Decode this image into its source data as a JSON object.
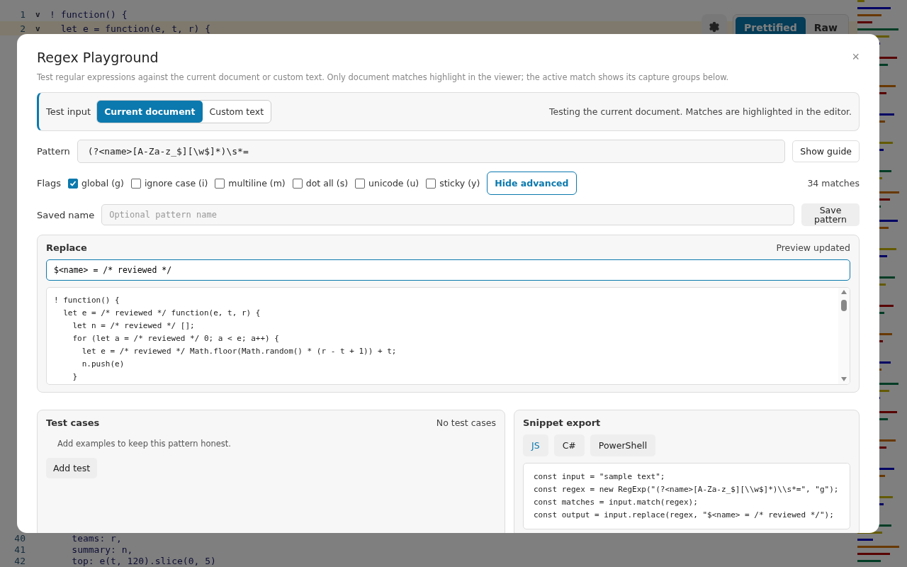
{
  "editor": {
    "lines_top": [
      {
        "number": "1",
        "fold": "v",
        "code": "! function() {",
        "current": false
      },
      {
        "number": "2",
        "fold": "v",
        "code": "  let e = function(e, t, r) {",
        "current": true
      }
    ],
    "lines_bottom": [
      {
        "number": "40",
        "code": "    teams: r,",
        "current": false
      },
      {
        "number": "41",
        "code": "    summary: n,",
        "current": false
      },
      {
        "number": "42",
        "code": "    top: e(t, 120).slice(0, 5)",
        "current": false
      }
    ]
  },
  "view_toggle": [
    {
      "label": "Prettified",
      "selected": true
    },
    {
      "label": "Raw",
      "selected": false
    }
  ],
  "modal": {
    "title": "Regex Playground",
    "close": "×",
    "description": "Test regular expressions against the current document or custom text. Only document matches highlight in the viewer; the active match shows its capture groups below.",
    "test_input": {
      "label": "Test input",
      "options": [
        {
          "label": "Current document",
          "selected": true
        },
        {
          "label": "Custom text",
          "selected": false
        }
      ],
      "status": "Testing the current document. Matches are highlighted in the editor."
    },
    "pattern": {
      "label": "Pattern",
      "value": "(?<name>[A-Za-z_$][\\w$]*)\\s*=",
      "button": "Show guide"
    },
    "flags": {
      "label": "Flags",
      "items": [
        {
          "label": "global (g)",
          "checked": true
        },
        {
          "label": "ignore case (i)",
          "checked": false
        },
        {
          "label": "multiline (m)",
          "checked": false
        },
        {
          "label": "dot all (s)",
          "checked": false
        },
        {
          "label": "unicode (u)",
          "checked": false
        },
        {
          "label": "sticky (y)",
          "checked": false
        }
      ],
      "button": "Hide advanced",
      "match_count": "34 matches"
    },
    "saved_name": {
      "label": "Saved name",
      "placeholder": "Optional pattern name",
      "button": "Save pattern"
    },
    "replace": {
      "title": "Replace",
      "status": "Preview updated",
      "value": "$<name> = /* reviewed */",
      "preview": [
        "! function() {",
        "  let e = /* reviewed */ function(e, t, r) {",
        "    let n = /* reviewed */ [];",
        "    for (let a = /* reviewed */ 0; a < e; a++) {",
        "      let e = /* reviewed */ Math.floor(Math.random() * (r - t + 1)) + t;",
        "      n.push(e)",
        "    }"
      ]
    },
    "test_cases": {
      "title": "Test cases",
      "status": "No test cases",
      "empty": "Add examples to keep this pattern honest.",
      "button": "Add test"
    },
    "snippet": {
      "title": "Snippet export",
      "tabs": [
        {
          "label": "JS",
          "selected": true
        },
        {
          "label": "C#",
          "selected": false
        },
        {
          "label": "PowerShell",
          "selected": false
        }
      ],
      "code": [
        "const input = \"sample text\";",
        "const regex = new RegExp(\"(?<name>[A-Za-z_$][\\\\w$]*)\\\\s*=\", \"g\");",
        "const matches = input.match(regex);",
        "const output = input.replace(regex, \"$<name> = /* reviewed */\");"
      ]
    }
  }
}
